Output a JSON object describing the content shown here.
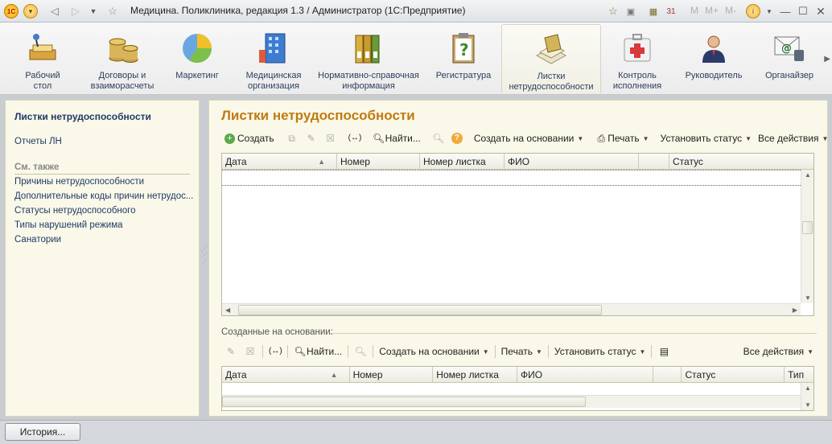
{
  "window": {
    "title": "Медицина. Поликлиника, редакция 1.3 / Администратор  (1С:Предприятие)",
    "buttons": {
      "m": "M",
      "mplus": "M+",
      "mminus": "M-"
    }
  },
  "sections": [
    {
      "label": "Рабочий\nстол",
      "icon": "desk-icon"
    },
    {
      "label": "Договоры и\nвзаиморасчеты",
      "icon": "coins-icon"
    },
    {
      "label": "Маркетинг",
      "icon": "pie-chart-icon"
    },
    {
      "label": "Медицинская\nорганизация",
      "icon": "building-icon"
    },
    {
      "label": "Нормативно-справочная\nинформация",
      "icon": "binders-icon"
    },
    {
      "label": "Регистратура",
      "icon": "clipboard-icon"
    },
    {
      "label": "Листки\nнетрудоспособности",
      "icon": "papers-icon"
    },
    {
      "label": "Контроль\nисполнения",
      "icon": "first-aid-icon"
    },
    {
      "label": "Руководитель",
      "icon": "manager-icon"
    },
    {
      "label": "Органайзер",
      "icon": "organizer-icon"
    }
  ],
  "leftnav": {
    "active": "Листки нетрудоспособности",
    "reports": "Отчеты ЛН",
    "see_also": "См. также",
    "links": [
      "Причины нетрудоспособности",
      "Дополнительные коды причин нетрудос...",
      "Статусы нетрудоспособного",
      "Типы нарушений режима",
      "Санатории"
    ]
  },
  "form": {
    "title": "Листки нетрудоспособности",
    "toolbar": {
      "create": "Создать",
      "find": "Найти...",
      "create_based": "Создать на основании",
      "print": "Печать",
      "set_status": "Установить статус",
      "all_actions": "Все действия"
    },
    "grid": {
      "columns": [
        "Дата",
        "Номер",
        "Номер листка",
        "ФИО",
        "",
        "Статус"
      ]
    },
    "sub": {
      "header": "Созданные на основании:",
      "toolbar": {
        "find": "Найти...",
        "create_based": "Создать на основании",
        "print": "Печать",
        "set_status": "Установить статус",
        "all_actions": "Все действия"
      },
      "columns": [
        "Дата",
        "Номер",
        "Номер листка",
        "ФИО",
        "",
        "Статус",
        "Тип"
      ]
    }
  },
  "statusbar": {
    "history": "История..."
  }
}
